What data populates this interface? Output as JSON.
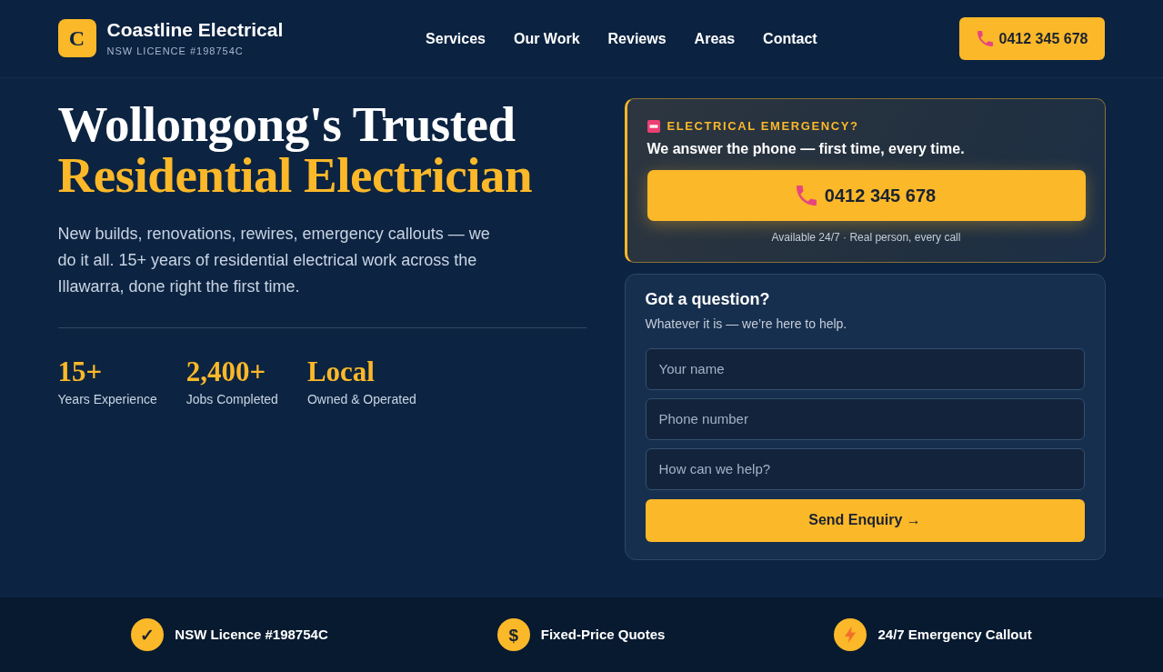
{
  "header": {
    "logo_letter": "C",
    "brand": "Coastline Electrical",
    "licence": "NSW LICENCE #198754C",
    "nav": [
      {
        "label": "Services"
      },
      {
        "label": "Our Work"
      },
      {
        "label": "Reviews"
      },
      {
        "label": "Areas"
      },
      {
        "label": "Contact"
      }
    ],
    "phone_button": "0412 345 678"
  },
  "hero": {
    "title_line_1": "Wollongong's Trusted",
    "title_line_2": "Residential Electrician",
    "intro": "New builds, renovations, rewires, emergency callouts — we do it all. 15+ years of residential electrical work across the Illawarra, done right the first time.",
    "stats": [
      {
        "value": "15+",
        "label": "Years Experience"
      },
      {
        "value": "2,400+",
        "label": "Jobs Completed"
      },
      {
        "value": "Local",
        "label": "Owned & Operated"
      }
    ]
  },
  "emergency": {
    "eyebrow": "ELECTRICAL EMERGENCY?",
    "tagline": "We answer the phone — first time, every time.",
    "call_button": "0412 345 678",
    "note": "Available 24/7 · Real person, every call"
  },
  "enquiry_form": {
    "title": "Got a question?",
    "subtitle": "Whatever it is — we’re here to help.",
    "fields": [
      {
        "placeholder": "Your name"
      },
      {
        "placeholder": "Phone number"
      },
      {
        "placeholder": "How can we help?"
      }
    ],
    "submit": "Send Enquiry →"
  },
  "trust_bar": [
    {
      "kind": "check",
      "symbol": "✓",
      "label": "NSW Licence #198754C"
    },
    {
      "kind": "dollar",
      "symbol": "$",
      "label": "Fixed-Price Quotes"
    },
    {
      "kind": "bolt",
      "label": "24/7 Emergency Callout"
    }
  ]
}
